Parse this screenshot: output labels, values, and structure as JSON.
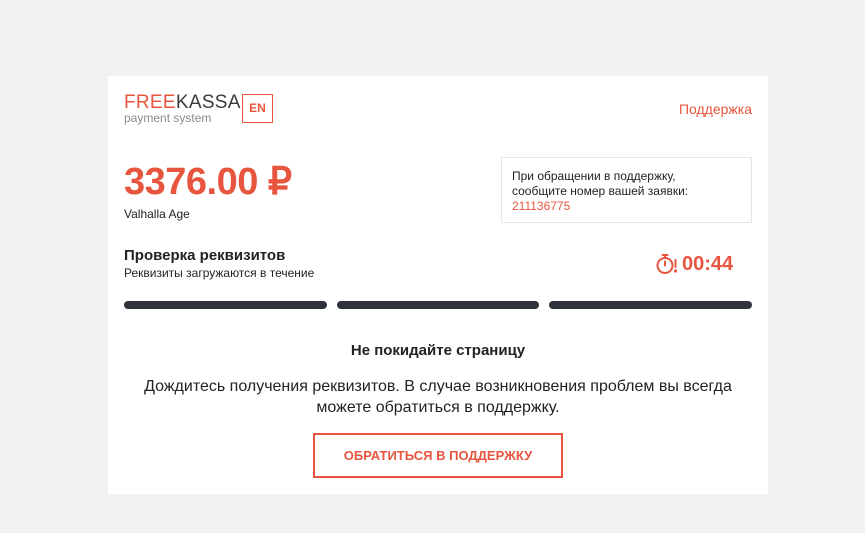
{
  "brand": {
    "name_part1": "FREE",
    "name_part2": "KASSA",
    "subtitle": "payment system"
  },
  "header": {
    "lang_button": "EN",
    "support_link": "Поддержка"
  },
  "payment": {
    "amount": "3376.00 ₽",
    "merchant": "Valhalla Age"
  },
  "notice": {
    "line1": "При обращении в поддержку,",
    "line2": "сообщите номер вашей заявки:",
    "order_number": "211136775"
  },
  "status": {
    "title": "Проверка реквизитов",
    "subtitle": "Реквизиты загружаются в течение",
    "timer": "00:44",
    "timer_icon": "stopwatch-icon",
    "progress_segments": 3
  },
  "message": {
    "title": "Не покидайте страницу",
    "text": "Дождитесь получения реквизитов. В случае возникновения проблем вы всегда можете обратиться в поддержку."
  },
  "actions": {
    "contact_support": "ОБРАТИТЬСЯ В ПОДДЕРЖКУ"
  },
  "colors": {
    "accent": "#e8553f",
    "progress": "#2e323b",
    "background": "#f2f1f3"
  }
}
